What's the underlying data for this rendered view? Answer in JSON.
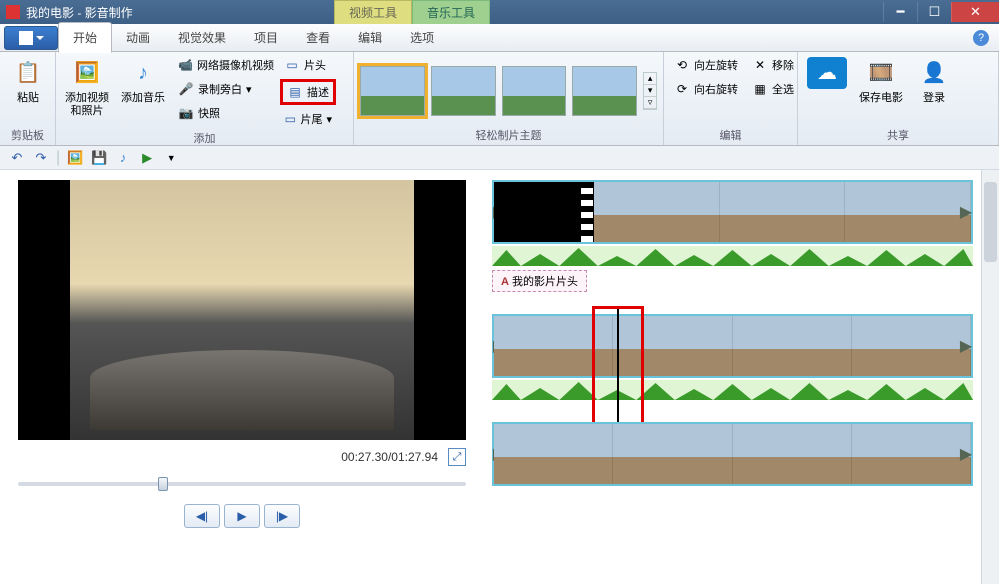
{
  "window": {
    "title": "我的电影 - 影音制作",
    "context_tabs": {
      "video": "视频工具",
      "audio": "音乐工具"
    }
  },
  "tabs": {
    "file": "",
    "items": [
      "开始",
      "动画",
      "视觉效果",
      "项目",
      "查看",
      "编辑",
      "选项"
    ],
    "active": "开始"
  },
  "ribbon": {
    "clipboard": {
      "paste": "粘贴",
      "label": "剪贴板"
    },
    "add": {
      "label": "添加",
      "add_video_photo": "添加视频\n和照片",
      "add_music": "添加音乐",
      "webcam": "网络摄像机视频",
      "narration": "录制旁白",
      "snapshot": "快照",
      "title_clip": "片头",
      "caption": "描述",
      "credits": "片尾"
    },
    "themes": {
      "label": "轻松制片主题"
    },
    "edit": {
      "label": "编辑",
      "rotate_left": "向左旋转",
      "rotate_right": "向右旋转",
      "remove": "移除",
      "select_all": "全选"
    },
    "share": {
      "label": "共享",
      "save_movie": "保存电影",
      "signin": "登录"
    }
  },
  "preview": {
    "time_current": "00:27.30",
    "time_total": "01:27.94"
  },
  "timeline": {
    "caption_text": "我的影片片头"
  }
}
